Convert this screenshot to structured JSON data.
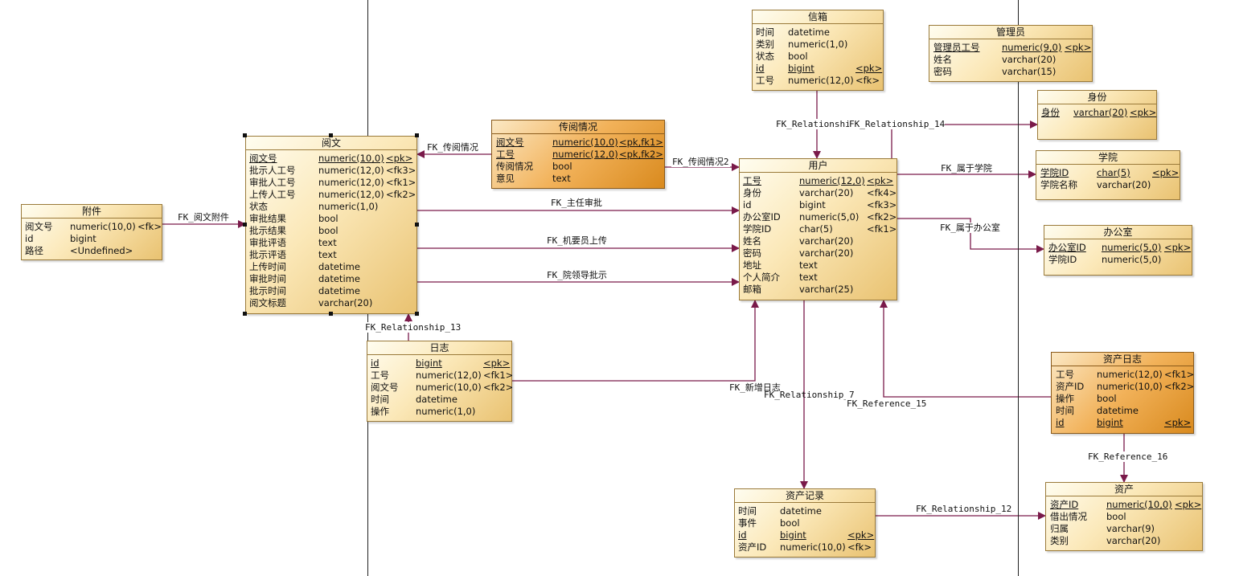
{
  "colors": {
    "line": "#7a1a4a",
    "entity_border": "#9a7a3a",
    "entity_fill_light": "#fbe8b8",
    "entity_fill_dark": "#e9a44a"
  },
  "entities": {
    "yuewen": {
      "title": "阅文",
      "attrs": [
        {
          "name": "阅文号",
          "type": "numeric(10,0)",
          "key": "<pk>",
          "u": true
        },
        {
          "name": "批示人工号",
          "type": "numeric(12,0)",
          "key": "<fk3>",
          "u": false
        },
        {
          "name": "审批人工号",
          "type": "numeric(12,0)",
          "key": "<fk1>",
          "u": false
        },
        {
          "name": "上传人工号",
          "type": "numeric(12,0)",
          "key": "<fk2>",
          "u": false
        },
        {
          "name": "状态",
          "type": "numeric(1,0)",
          "key": "",
          "u": false
        },
        {
          "name": "审批结果",
          "type": "bool",
          "key": "",
          "u": false
        },
        {
          "name": "批示结果",
          "type": "bool",
          "key": "",
          "u": false
        },
        {
          "name": "审批评语",
          "type": "text",
          "key": "",
          "u": false
        },
        {
          "name": "批示评语",
          "type": "text",
          "key": "",
          "u": false
        },
        {
          "name": "上传时间",
          "type": "datetime",
          "key": "",
          "u": false
        },
        {
          "name": "审批时间",
          "type": "datetime",
          "key": "",
          "u": false
        },
        {
          "name": "批示时间",
          "type": "datetime",
          "key": "",
          "u": false
        },
        {
          "name": "阅文标题",
          "type": "varchar(20)",
          "key": "",
          "u": false
        }
      ]
    },
    "fujian": {
      "title": "附件",
      "attrs": [
        {
          "name": "阅文号",
          "type": "numeric(10,0)",
          "key": "<fk>",
          "u": false
        },
        {
          "name": "id",
          "type": "bigint",
          "key": "",
          "u": false
        },
        {
          "name": "路径",
          "type": "<Undefined>",
          "key": "",
          "u": false
        }
      ]
    },
    "chuanyue": {
      "title": "传阅情况",
      "attrs": [
        {
          "name": "阅文号",
          "type": "numeric(10,0)",
          "key": "<pk,fk1>",
          "u": true
        },
        {
          "name": "工号",
          "type": "numeric(12,0)",
          "key": "<pk,fk2>",
          "u": true
        },
        {
          "name": "传阅情况",
          "type": "bool",
          "key": "",
          "u": false
        },
        {
          "name": "意见",
          "type": "text",
          "key": "",
          "u": false
        }
      ]
    },
    "xinxiang": {
      "title": "信箱",
      "attrs": [
        {
          "name": "时间",
          "type": "datetime",
          "key": "",
          "u": false
        },
        {
          "name": "类别",
          "type": "numeric(1,0)",
          "key": "",
          "u": false
        },
        {
          "name": "状态",
          "type": "bool",
          "key": "",
          "u": false
        },
        {
          "name": "id",
          "type": "bigint",
          "key": "<pk>",
          "u": true
        },
        {
          "name": "工号",
          "type": "numeric(12,0)",
          "key": "<fk>",
          "u": false
        }
      ]
    },
    "guanliyuan": {
      "title": "管理员",
      "attrs": [
        {
          "name": "管理员工号",
          "type": "numeric(9,0)",
          "key": "<pk>",
          "u": true
        },
        {
          "name": "姓名",
          "type": "varchar(20)",
          "key": "",
          "u": false
        },
        {
          "name": "密码",
          "type": "varchar(15)",
          "key": "",
          "u": false
        }
      ]
    },
    "shenfen": {
      "title": "身份",
      "attrs": [
        {
          "name": "身份",
          "type": "varchar(20)",
          "key": "<pk>",
          "u": true
        }
      ]
    },
    "xueyuan": {
      "title": "学院",
      "attrs": [
        {
          "name": "学院ID",
          "type": "char(5)",
          "key": "<pk>",
          "u": true
        },
        {
          "name": "学院名称",
          "type": "varchar(20)",
          "key": "",
          "u": false
        }
      ]
    },
    "bangongshi": {
      "title": "办公室",
      "attrs": [
        {
          "name": "办公室ID",
          "type": "numeric(5,0)",
          "key": "<pk>",
          "u": true
        },
        {
          "name": "学院ID",
          "type": "numeric(5,0)",
          "key": "",
          "u": false
        }
      ]
    },
    "yonghu": {
      "title": "用户",
      "attrs": [
        {
          "name": "工号",
          "type": "numeric(12,0)",
          "key": "<pk>",
          "u": true
        },
        {
          "name": "身份",
          "type": "varchar(20)",
          "key": "<fk4>",
          "u": false
        },
        {
          "name": "id",
          "type": "bigint",
          "key": "<fk3>",
          "u": false
        },
        {
          "name": "办公室ID",
          "type": "numeric(5,0)",
          "key": "<fk2>",
          "u": false
        },
        {
          "name": "学院ID",
          "type": "char(5)",
          "key": "<fk1>",
          "u": false
        },
        {
          "name": "姓名",
          "type": "varchar(20)",
          "key": "",
          "u": false
        },
        {
          "name": "密码",
          "type": "varchar(20)",
          "key": "",
          "u": false
        },
        {
          "name": "地址",
          "type": "text",
          "key": "",
          "u": false
        },
        {
          "name": "个人简介",
          "type": "text",
          "key": "",
          "u": false
        },
        {
          "name": "邮箱",
          "type": "varchar(25)",
          "key": "",
          "u": false
        }
      ]
    },
    "rizhi": {
      "title": "日志",
      "attrs": [
        {
          "name": "id",
          "type": "bigint",
          "key": "<pk>",
          "u": true
        },
        {
          "name": "工号",
          "type": "numeric(12,0)",
          "key": "<fk1>",
          "u": false
        },
        {
          "name": "阅文号",
          "type": "numeric(10,0)",
          "key": "<fk2>",
          "u": false
        },
        {
          "name": "时间",
          "type": "datetime",
          "key": "",
          "u": false
        },
        {
          "name": "操作",
          "type": "numeric(1,0)",
          "key": "",
          "u": false
        }
      ]
    },
    "zichanrizhi": {
      "title": "资产日志",
      "attrs": [
        {
          "name": "工号",
          "type": "numeric(12,0)",
          "key": "<fk1>",
          "u": false
        },
        {
          "name": "资产ID",
          "type": "numeric(10,0)",
          "key": "<fk2>",
          "u": false
        },
        {
          "name": "操作",
          "type": "bool",
          "key": "",
          "u": false
        },
        {
          "name": "时间",
          "type": "datetime",
          "key": "",
          "u": false
        },
        {
          "name": "id",
          "type": "bigint",
          "key": "<pk>",
          "u": true
        }
      ]
    },
    "zichanjilu": {
      "title": "资产记录",
      "attrs": [
        {
          "name": "时间",
          "type": "datetime",
          "key": "",
          "u": false
        },
        {
          "name": "事件",
          "type": "bool",
          "key": "",
          "u": false
        },
        {
          "name": "id",
          "type": "bigint",
          "key": "<pk>",
          "u": true
        },
        {
          "name": "资产ID",
          "type": "numeric(10,0)",
          "key": "<fk>",
          "u": false
        }
      ]
    },
    "zichan": {
      "title": "资产",
      "attrs": [
        {
          "name": "资产ID",
          "type": "numeric(10,0)",
          "key": "<pk>",
          "u": true
        },
        {
          "name": "借出情况",
          "type": "bool",
          "key": "",
          "u": false
        },
        {
          "name": "归属",
          "type": "varchar(9)",
          "key": "",
          "u": false
        },
        {
          "name": "类别",
          "type": "varchar(20)",
          "key": "",
          "u": false
        }
      ]
    }
  },
  "relationships": {
    "r_yuewen_fujian": "FK_阅文附件",
    "r_chuanyue_yuewen": "FK_传阅情况",
    "r_chuanyue_yonghu": "FK_传阅情况2",
    "r_zhuren": "FK_主任审批",
    "r_jiyao": "FK_机要员上传",
    "r_yuanling": "FK_院领导批示",
    "r_rizhi_yuewen": "FK_Relationship_13",
    "r_xinxiang_yonghu": "FK_Relationship",
    "r_shenfen": "FK_Relationship_14",
    "r_xueyuan": "FK_属于学院",
    "r_bangongshi": "FK_属于办公室",
    "r_rizhi_yonghu": "FK_新增日志",
    "r_jilu_yonghu": "FK_Relationship_7",
    "r_zichanrizhi_yonghu": "FK_Reference_15",
    "r_zichanrizhi_zichan": "FK_Reference_16",
    "r_jilu_zichan": "FK_Relationship_12"
  }
}
